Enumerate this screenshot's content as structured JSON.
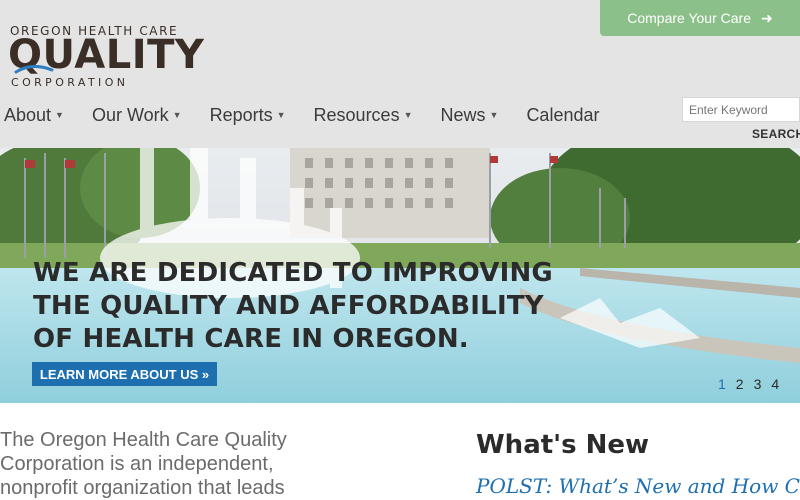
{
  "logo": {
    "line1": "OREGON HEALTH CARE",
    "line2": "QUALITY",
    "line3": "CORPORATION"
  },
  "compare_button": {
    "label": "Compare Your Care",
    "icon": "arrow-right-icon"
  },
  "nav": {
    "items": [
      {
        "label": "About",
        "has_dropdown": true
      },
      {
        "label": "Our Work",
        "has_dropdown": true
      },
      {
        "label": "Reports",
        "has_dropdown": true
      },
      {
        "label": "Resources",
        "has_dropdown": true
      },
      {
        "label": "News",
        "has_dropdown": true
      },
      {
        "label": "Calendar",
        "has_dropdown": false
      }
    ]
  },
  "search": {
    "placeholder": "Enter Keyword",
    "button_label": "SEARCH"
  },
  "hero": {
    "headline_lines": [
      "WE ARE DEDICATED TO IMPROVING",
      "THE QUALITY AND AFFORDABILITY",
      "OF HEALTH CARE IN OREGON."
    ],
    "cta_label": "LEARN MORE ABOUT US »",
    "pager": [
      "1",
      "2",
      "3",
      "4"
    ],
    "active_page": "1"
  },
  "intro": {
    "text": "The Oregon Health Care Quality Corporation is an independent, nonprofit organization that leads"
  },
  "whats_new": {
    "title": "What's New",
    "first_link": "POLST: What’s New and How Can"
  },
  "colors": {
    "header_bg": "#e4e4e4",
    "compare_bg": "#8cc08a",
    "accent_blue": "#1d6fb0",
    "text_dark": "#2b2b2b"
  }
}
